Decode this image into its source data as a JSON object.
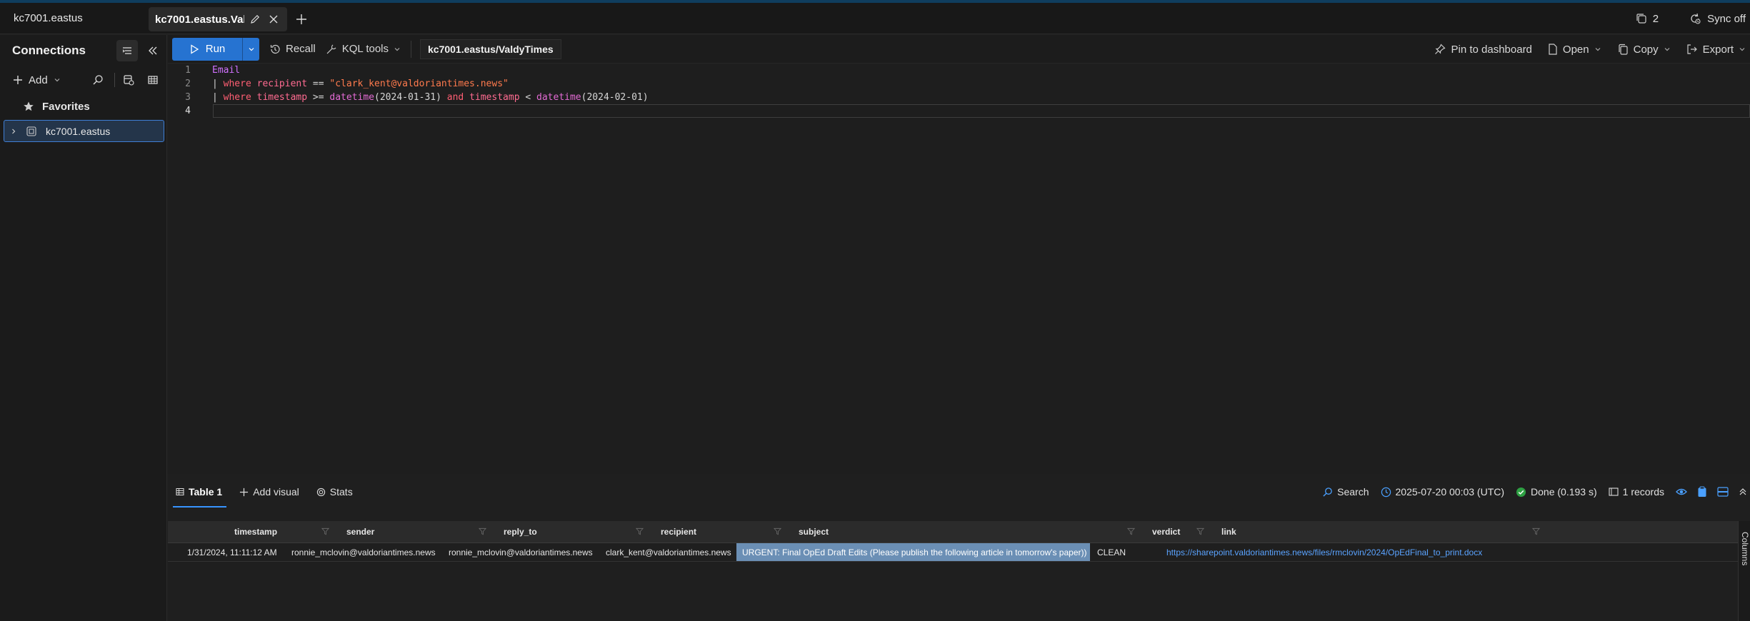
{
  "window": {
    "cluster_name": "kc7001.eastus",
    "tab_label": "kc7001.eastus.Valdy...",
    "duplicates_count": "2",
    "sync_label": "Sync off"
  },
  "left_panel": {
    "title": "Connections",
    "add_label": "Add",
    "favorites_label": "Favorites",
    "connection_label": "kc7001.eastus"
  },
  "toolbar": {
    "run_label": "Run",
    "recall_label": "Recall",
    "kql_tools_label": "KQL tools",
    "database_label": "kc7001.eastus/ValdyTimes",
    "pin_label": "Pin to dashboard",
    "open_label": "Open",
    "copy_label": "Copy",
    "export_label": "Export"
  },
  "editor": {
    "line_numbers": [
      "1",
      "2",
      "3",
      "4"
    ],
    "line1": {
      "table": "Email"
    },
    "line2": {
      "pipe": "| ",
      "kw": "where",
      "col": "recipient",
      "op": " == ",
      "str": "\"clark_kent@valdoriantimes.news\""
    },
    "line3": {
      "pipe": "| ",
      "kw": "where",
      "col1": "timestamp",
      "op1": " >= ",
      "fn1": "datetime",
      "arg1": "(2024-01-31)",
      "and": " and ",
      "col2": "timestamp",
      "op2": " < ",
      "fn2": "datetime",
      "arg2": "(2024-02-01)"
    }
  },
  "results": {
    "tabs": [
      "Table 1",
      "Add visual",
      "Stats"
    ],
    "search_label": "Search",
    "time_label": "2025-07-20 00:03 (UTC)",
    "status_label": "Done (0.193 s)",
    "records_label": "1 records",
    "columns_label": "Columns",
    "columns": [
      "timestamp",
      "sender",
      "reply_to",
      "recipient",
      "subject",
      "verdict",
      "link"
    ],
    "rows": [
      {
        "timestamp": "1/31/2024, 11:11:12 AM",
        "sender": "ronnie_mclovin@valdoriantimes.news",
        "reply_to": "ronnie_mclovin@valdoriantimes.news",
        "recipient": "clark_kent@valdoriantimes.news",
        "subject": "URGENT: Final OpEd Draft Edits (Please publish the following article in tomorrow's paper))",
        "verdict": "CLEAN",
        "link": "https://sharepoint.valdoriantimes.news/files/rmclovin/2024/OpEdFinal_to_print.docx"
      }
    ]
  },
  "colors": {
    "accent": "#2673d1",
    "selection": "#6b8fb5",
    "link": "#5aa3ff",
    "success": "#2ea043"
  }
}
